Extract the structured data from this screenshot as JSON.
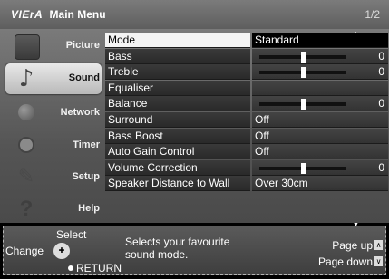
{
  "header": {
    "brand": "VIErA",
    "title": "Main Menu",
    "page_indicator": "1/2"
  },
  "sidebar": {
    "items": [
      {
        "label": "Picture",
        "icon": "picture-icon",
        "active": false
      },
      {
        "label": "Sound",
        "icon": "music-note-icon",
        "active": true
      },
      {
        "label": "Network",
        "icon": "globe-icon",
        "active": false
      },
      {
        "label": "Timer",
        "icon": "clock-icon",
        "active": false
      },
      {
        "label": "Setup",
        "icon": "wrench-icon",
        "active": false
      },
      {
        "label": "Help",
        "icon": "question-icon",
        "active": false
      }
    ]
  },
  "menu": {
    "rows": [
      {
        "label": "Mode",
        "value": "Standard",
        "type": "text",
        "selected": true
      },
      {
        "label": "Bass",
        "value": "0",
        "type": "slider",
        "level": 0.5
      },
      {
        "label": "Treble",
        "value": "0",
        "type": "slider",
        "level": 0.5
      },
      {
        "label": "Equaliser",
        "value": "",
        "type": "text"
      },
      {
        "label": "Balance",
        "value": "0",
        "type": "slider",
        "level": 0.5
      },
      {
        "label": "Surround",
        "value": "Off",
        "type": "text"
      },
      {
        "label": "Bass Boost",
        "value": "Off",
        "type": "text"
      },
      {
        "label": "Auto Gain Control",
        "value": "Off",
        "type": "text"
      },
      {
        "label": "Volume Correction",
        "value": "0",
        "type": "slider",
        "level": 0.5
      },
      {
        "label": "Speaker Distance to Wall",
        "value": "Over 30cm",
        "type": "text"
      }
    ]
  },
  "help": {
    "select": "Select",
    "change": "Change",
    "return": "RETURN",
    "description": "Selects your favourite sound mode.",
    "page_up": "Page up",
    "page_down": "Page down"
  }
}
